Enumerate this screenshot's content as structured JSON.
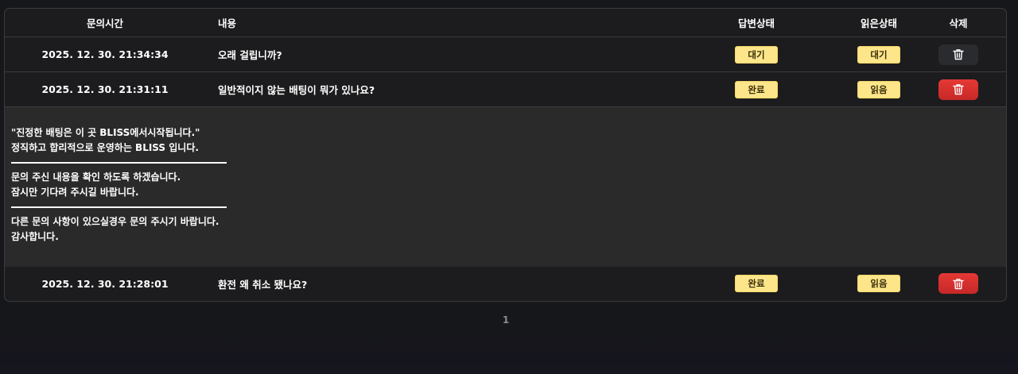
{
  "table": {
    "headers": {
      "time": "문의시간",
      "content": "내용",
      "answer_status": "답변상태",
      "read_status": "읽은상태",
      "delete": "삭제"
    },
    "rows": [
      {
        "time": "2025. 12. 30. 21:34:34",
        "content": "오래 걸립니까?",
        "answer_status": "대기",
        "read_status": "대기",
        "delete_icon": "trash-icon",
        "delete_style": "dark"
      },
      {
        "time": "2025. 12. 30. 21:31:11",
        "content": "일반적이지 않는 배팅이 뭐가 있나요?",
        "answer_status": "완료",
        "read_status": "읽음",
        "delete_icon": "trash-icon",
        "delete_style": "red"
      },
      {
        "time": "2025. 12. 30. 21:28:01",
        "content": "환전 왜 취소 됐나요?",
        "answer_status": "완료",
        "read_status": "읽음",
        "delete_icon": "trash-icon",
        "delete_style": "red"
      }
    ],
    "expanded_answer": {
      "para1": [
        "\"진정한 배팅은 이 곳 BLISS에서시작됩니다.\"",
        "정직하고 합리적으로 운영하는 BLISS 입니다."
      ],
      "para2": [
        "문의 주신 내용을 확인 하도록 하겠습니다.",
        "잠시만 기다려 주시길 바랍니다."
      ],
      "para3": [
        "다른 문의 사항이 있으실경우 문의 주시기 바랍니다.",
        "감사합니다."
      ]
    }
  },
  "pagination": {
    "current_page": "1"
  },
  "colors": {
    "badge_bg": "#fde68a",
    "delete_red": "#e53935",
    "background": "#16171a"
  }
}
